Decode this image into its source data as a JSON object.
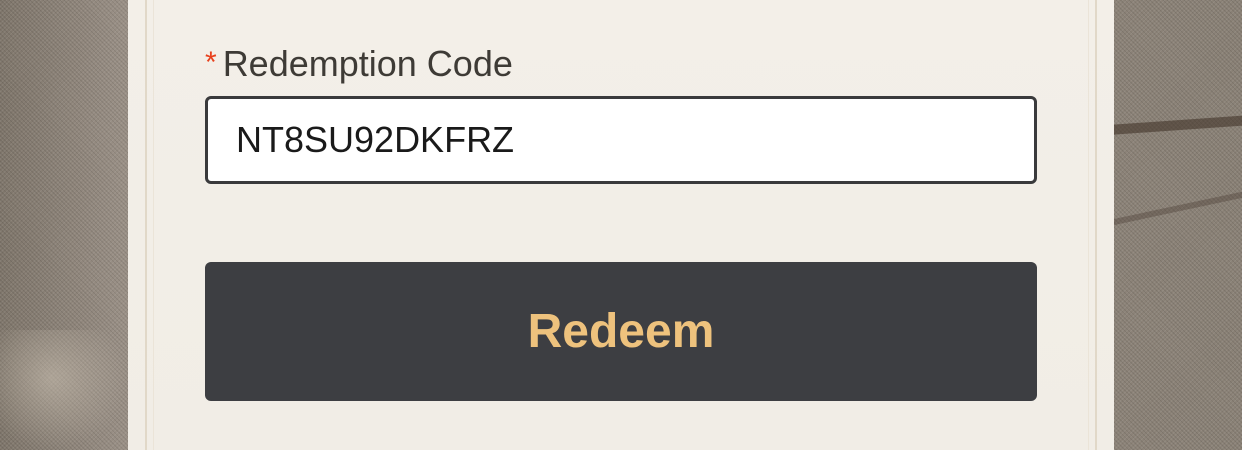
{
  "form": {
    "required_mark": "*",
    "code_label": "Redemption Code",
    "code_value": "NT8SU92DKFRZ",
    "redeem_label": "Redeem"
  },
  "colors": {
    "required": "#e8401c",
    "button_bg": "#3d3e42",
    "button_text": "#eec27d",
    "panel_bg": "#f2eee7"
  }
}
